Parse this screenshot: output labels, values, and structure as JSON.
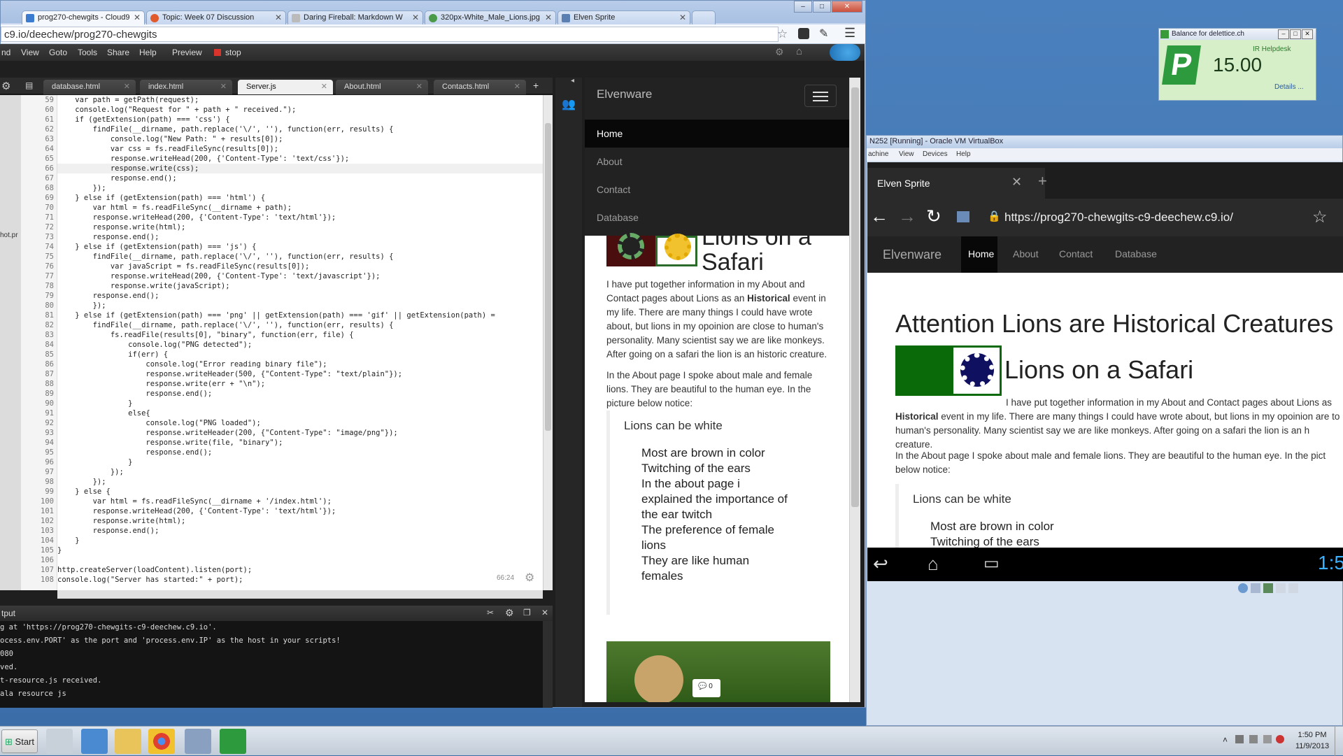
{
  "browser": {
    "tabs": [
      {
        "label": "prog270-chewgits - Cloud9",
        "color": "#3b7bd0"
      },
      {
        "label": "Topic: Week 07 Discussion",
        "color": "#e05a2b"
      },
      {
        "label": "Daring Fireball: Markdown W",
        "color": "#555555"
      },
      {
        "label": "320px-White_Male_Lions.jpg",
        "color": "#4a9a4a"
      },
      {
        "label": "Elven Sprite",
        "color": "#5a7fb0"
      }
    ],
    "url": "c9.io/deechew/prog270-chewgits",
    "window_controls": {
      "min": "–",
      "max": "□",
      "close": "✕"
    }
  },
  "ide": {
    "menu": [
      "nd",
      "View",
      "Goto",
      "Tools",
      "Share",
      "Help"
    ],
    "preview_label": "Preview",
    "stop_label": "stop",
    "editor_tabs": [
      "database.html",
      "index.html",
      "Server.js",
      "About.html",
      "Contacts.html"
    ],
    "active_tab": "Server.js",
    "side_label": "hot.pr",
    "cursor_pos": "66:24",
    "line_numbers": [
      "59",
      "60",
      "61",
      "62",
      "63",
      "64",
      "65",
      "66",
      "67",
      "68",
      "69",
      "70",
      "71",
      "72",
      "73",
      "74",
      "75",
      "76",
      "77",
      "78",
      "79",
      "80",
      "81",
      "82",
      "83",
      "84",
      "85",
      "86",
      "87",
      "88",
      "89",
      "90",
      "91",
      "92",
      "93",
      "94",
      "95",
      "96",
      "97",
      "98",
      "99",
      "100",
      "101",
      "102",
      "103",
      "104",
      "105",
      "106",
      "107",
      "108"
    ],
    "code_lines": [
      "    var path = getPath(request);",
      "    console.log(\"Request for \" + path + \" received.\");",
      "    if (getExtension(path) === 'css') {",
      "        findFile(__dirname, path.replace('\\/', ''), function(err, results) {",
      "            console.log(\"New Path: \" + results[0]);",
      "            var css = fs.readFileSync(results[0]);",
      "            response.writeHead(200, {'Content-Type': 'text/css'});",
      "            response.write(css);",
      "            response.end();",
      "        });",
      "    } else if (getExtension(path) === 'html') {",
      "        var html = fs.readFileSync(__dirname + path);",
      "        response.writeHead(200, {'Content-Type': 'text/html'});",
      "        response.write(html);",
      "        response.end();",
      "    } else if (getExtension(path) === 'js') {",
      "        findFile(__dirname, path.replace('\\/', ''), function(err, results) {",
      "            var javaScript = fs.readFileSync(results[0]);",
      "            response.writeHead(200, {'Content-Type': 'text/javascript'});",
      "            response.write(javaScript);",
      "        response.end();",
      "        });",
      "    } else if (getExtension(path) === 'png' || getExtension(path) === 'gif' || getExtension(path) =",
      "        findFile(__dirname, path.replace('\\/', ''), function(err, results) {",
      "            fs.readFile(results[0], \"binary\", function(err, file) {",
      "                console.log(\"PNG detected\");",
      "                if(err) {",
      "                    console.log(\"Error reading binary file\");",
      "                    response.writeHeader(500, {\"Content-Type\": \"text/plain\"});",
      "                    response.write(err + \"\\n\");",
      "                    response.end();",
      "                }",
      "                else{",
      "                    console.log(\"PNG loaded\");",
      "                    response.writeHeader(200, {\"Content-Type\": \"image/png\"});",
      "                    response.write(file, \"binary\");",
      "                    response.end();",
      "                }",
      "            });",
      "        });",
      "    } else {",
      "        var html = fs.readFileSync(__dirname + '/index.html');",
      "        response.writeHead(200, {'Content-Type': 'text/html'});",
      "        response.write(html);",
      "        response.end();",
      "    }",
      "}",
      "",
      "http.createServer(loadContent).listen(port);",
      "console.log(\"Server has started:\" + port);"
    ],
    "output_title": "tput",
    "output_lines": [
      "g at 'https://prog270-chewgits-c9-deechew.c9.io'.",
      "ocess.env.PORT' as the port and 'process.env.IP' as the host in your scripts!",
      "080",
      "ved.",
      "t-resource.js received.",
      "ala resource js"
    ]
  },
  "preview_site": {
    "brand": "Elvenware",
    "nav": [
      "Home",
      "About",
      "Contact",
      "Database"
    ],
    "heading": "Lions on a Safari",
    "p1_before": "I have put together information in my About and Contact pages about Lions as an ",
    "p1_bold": "Historical",
    "p1_after": " event in my life. There are many things I could have wrote about, but lions in my opoinion are close to human's personality. Many scientist say we are like monkeys. After going on a safari the lion is an historic creature.",
    "p2": "In the About page I spoke about male and female lions. They are beautiful to the human eye. In the picture below notice:",
    "quote_title": "Lions can be white",
    "quote_items": [
      "Most are brown in color",
      "Twitching of the ears",
      "In the about page i explained the importance of the ear twitch",
      "The preference of female lions",
      "They are like human females"
    ],
    "comment_count": "0"
  },
  "balance": {
    "title": "Balance for delettice.ch",
    "link": "IR Helpdesk",
    "amount": "15.00",
    "details": "Details ..."
  },
  "vbox": {
    "title": "N252 [Running] - Oracle VM VirtualBox",
    "menu": [
      "achine",
      "View",
      "Devices",
      "Help"
    ],
    "tab_title": "Elven Sprite",
    "url": "https://prog270-chewgits-c9-deechew.c9.io/",
    "site_brand": "Elvenware",
    "site_nav": [
      "Home",
      "About",
      "Contact",
      "Database"
    ],
    "h1": "Attention Lions are Historical Creatures",
    "h2": "Lions on a Safari",
    "p1_before": "I have put together information in my About and Contact pages about Lions as",
    "p1_bold": "Historical",
    "p1_after": " event in my life. There are many things I could have wrote about, but lions in my opoinion are to human's personality. Many scientist say we are like monkeys. After going on a safari the lion is an h creature.",
    "p2": "In the About page I spoke about male and female lions. They are beautiful to the human eye. In the pict below notice:",
    "quote_title": "Lions can be white",
    "quote_items": [
      "Most are brown in color",
      "Twitching of the ears"
    ],
    "clock": "1:5"
  },
  "taskbar": {
    "start": "Start",
    "time": "1:50 PM",
    "date": "11/9/2013"
  }
}
